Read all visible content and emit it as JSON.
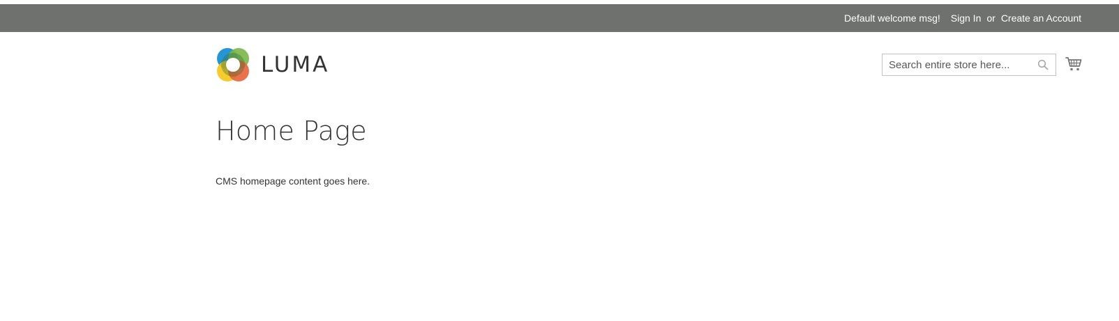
{
  "header": {
    "welcome": "Default welcome msg!",
    "sign_in": "Sign In",
    "or": "or",
    "create_account": "Create an Account"
  },
  "logo": {
    "text": "LUMA",
    "icon": "luma-logo-icon"
  },
  "search": {
    "placeholder": "Search entire store here...",
    "value": "",
    "icon": "search-icon"
  },
  "cart": {
    "icon": "cart-icon"
  },
  "main": {
    "title": "Home Page",
    "content": "CMS homepage content goes here."
  },
  "colors": {
    "header_bg": "#6e716e",
    "text": "#333333",
    "logo_blue": "#1a8fd1",
    "logo_green": "#7ab648",
    "logo_yellow": "#f5c518",
    "logo_orange": "#e8643a"
  }
}
